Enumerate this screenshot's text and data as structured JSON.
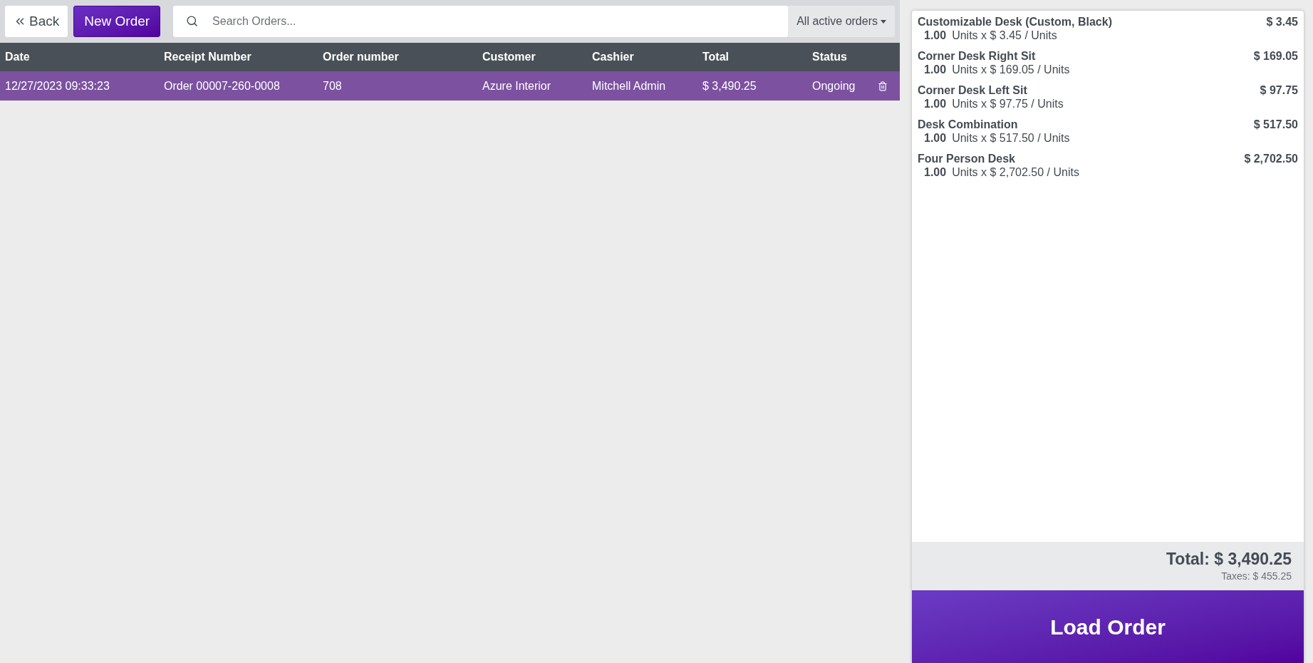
{
  "toolbar": {
    "back_label": "Back",
    "new_order_label": "New Order",
    "search": {
      "placeholder": "Search Orders..."
    },
    "filter_label": "All active orders"
  },
  "table": {
    "columns": [
      "Date",
      "Receipt Number",
      "Order number",
      "Customer",
      "Cashier",
      "Total",
      "Status"
    ],
    "rows": [
      {
        "cells": [
          "12/27/2023 09:33:23",
          "Order 00007-260-0008",
          "708",
          "Azure Interior",
          "Mitchell Admin",
          "$ 3,490.25",
          "Ongoing"
        ],
        "selected": true
      }
    ]
  },
  "order_lines": [
    {
      "product": "Customizable Desk (Custom, Black)",
      "price": "$ 3.45",
      "quantity": "1.00",
      "unit_info": "Units x $ 3.45 / Units"
    },
    {
      "product": "Corner Desk Right Sit",
      "price": "$ 169.05",
      "quantity": "1.00",
      "unit_info": "Units x $ 169.05 / Units"
    },
    {
      "product": "Corner Desk Left Sit",
      "price": "$ 97.75",
      "quantity": "1.00",
      "unit_info": "Units x $ 97.75 / Units"
    },
    {
      "product": "Desk Combination",
      "price": "$ 517.50",
      "quantity": "1.00",
      "unit_info": "Units x $ 517.50 / Units"
    },
    {
      "product": "Four Person Desk",
      "price": "$ 2,702.50",
      "quantity": "1.00",
      "unit_info": "Units x $ 2,702.50 / Units"
    }
  ],
  "summary": {
    "total": "Total: $ 3,490.25",
    "taxes": "Taxes: $ 455.25"
  },
  "load_button": "Load Order"
}
